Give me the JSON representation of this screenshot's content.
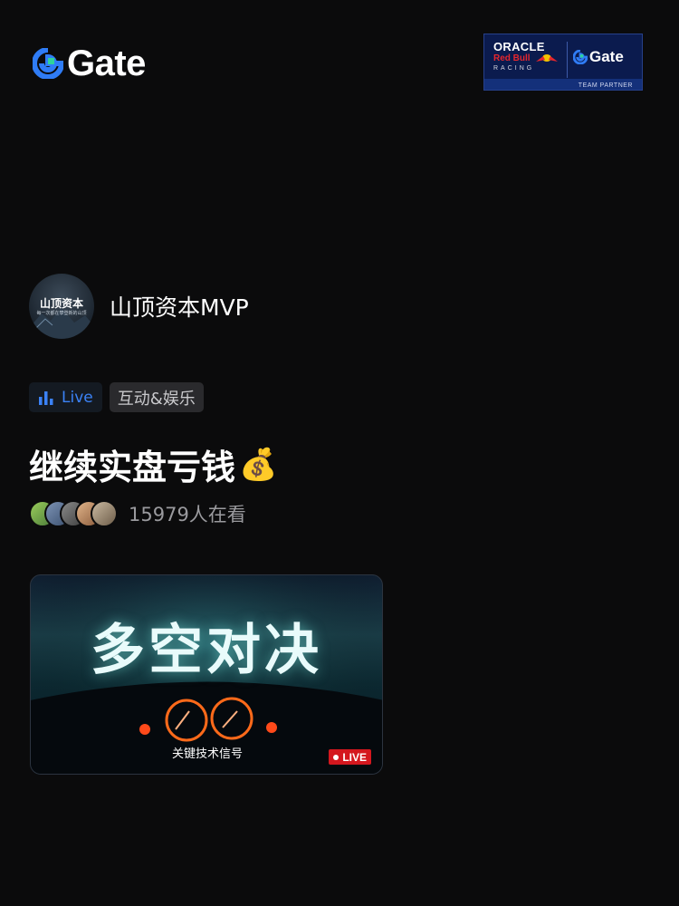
{
  "brand": {
    "name": "Gate",
    "accent": "#2f7cf6"
  },
  "partner": {
    "oracle": "ORACLE",
    "redbull": "Red Bull",
    "racing": "RACING",
    "gate": "Gate",
    "team": "TEAM PARTNER"
  },
  "host": {
    "avatar_title": "山顶资本",
    "avatar_subtitle": "每一次都在攀登新的山顶",
    "name": "山顶资本MVP"
  },
  "tags": {
    "live": "Live",
    "category": "互动&娱乐"
  },
  "stream": {
    "title": "继续实盘亏钱",
    "title_emoji": "💰",
    "viewers": "15979人在看"
  },
  "card": {
    "title": "多空对决",
    "subtitle": "关键技术信号",
    "badge": "LIVE",
    "badge_color": "#d4171e"
  },
  "icons": [
    "gate-logo-icon",
    "signal-bars-icon",
    "money-bag-icon",
    "live-dot-icon",
    "bull-logo-icon"
  ]
}
